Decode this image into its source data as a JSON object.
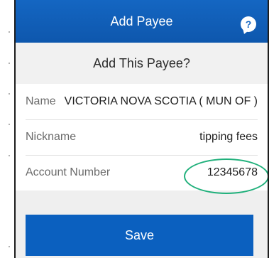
{
  "header": {
    "title": "Add Payee",
    "help_icon_glyph": "?"
  },
  "confirm": {
    "prompt": "Add This Payee?"
  },
  "fields": [
    {
      "label": "Name",
      "value": "VICTORIA NOVA SCOTIA ( MUN OF )"
    },
    {
      "label": "Nickname",
      "value": "tipping fees"
    },
    {
      "label": "Account Number",
      "value": "12345678"
    }
  ],
  "actions": {
    "save_label": "Save"
  },
  "colors": {
    "header_blue": "#1466c2",
    "button_blue": "#0b60bf",
    "highlight_green": "#20b07b"
  }
}
